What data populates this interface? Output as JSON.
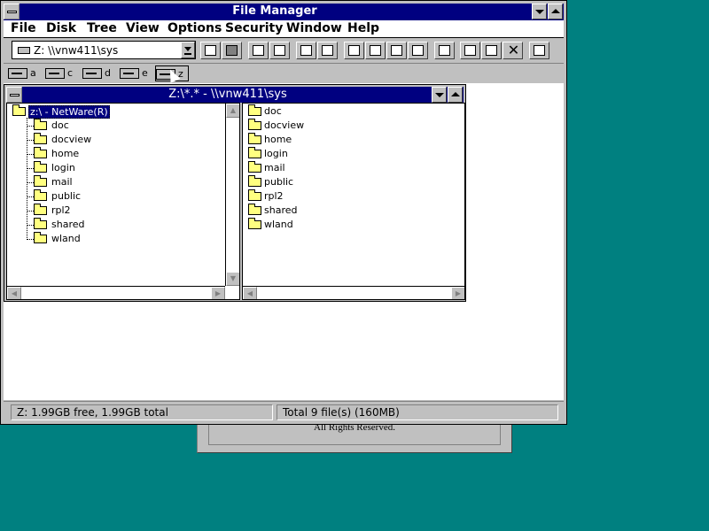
{
  "background_dialog": {
    "text": "All Rights Reserved."
  },
  "window": {
    "title": "File Manager",
    "menus": [
      "File",
      "Disk",
      "Tree",
      "View",
      "Options",
      "Security",
      "Window",
      "Help"
    ],
    "drive_select": "Z: \\\\vnw411\\sys",
    "drives": [
      "a",
      "c",
      "d",
      "e",
      "z"
    ],
    "selected_drive": "z"
  },
  "child": {
    "title": "Z:\\*.* - \\\\vnw411\\sys",
    "tree_root": "z:\\ - NetWare(R)",
    "tree": [
      "doc",
      "docview",
      "home",
      "login",
      "mail",
      "public",
      "rpl2",
      "shared",
      "wland"
    ],
    "files": [
      "doc",
      "docview",
      "home",
      "login",
      "mail",
      "public",
      "rpl2",
      "shared",
      "wland"
    ]
  },
  "status": {
    "left": "Z: 1.99GB free,  1.99GB total",
    "right": "Total 9 file(s) (160MB)"
  },
  "colors": {
    "desktop": "#008080",
    "titlebar": "#000080",
    "face": "#c0c0c0",
    "folder": "#ffff80"
  }
}
